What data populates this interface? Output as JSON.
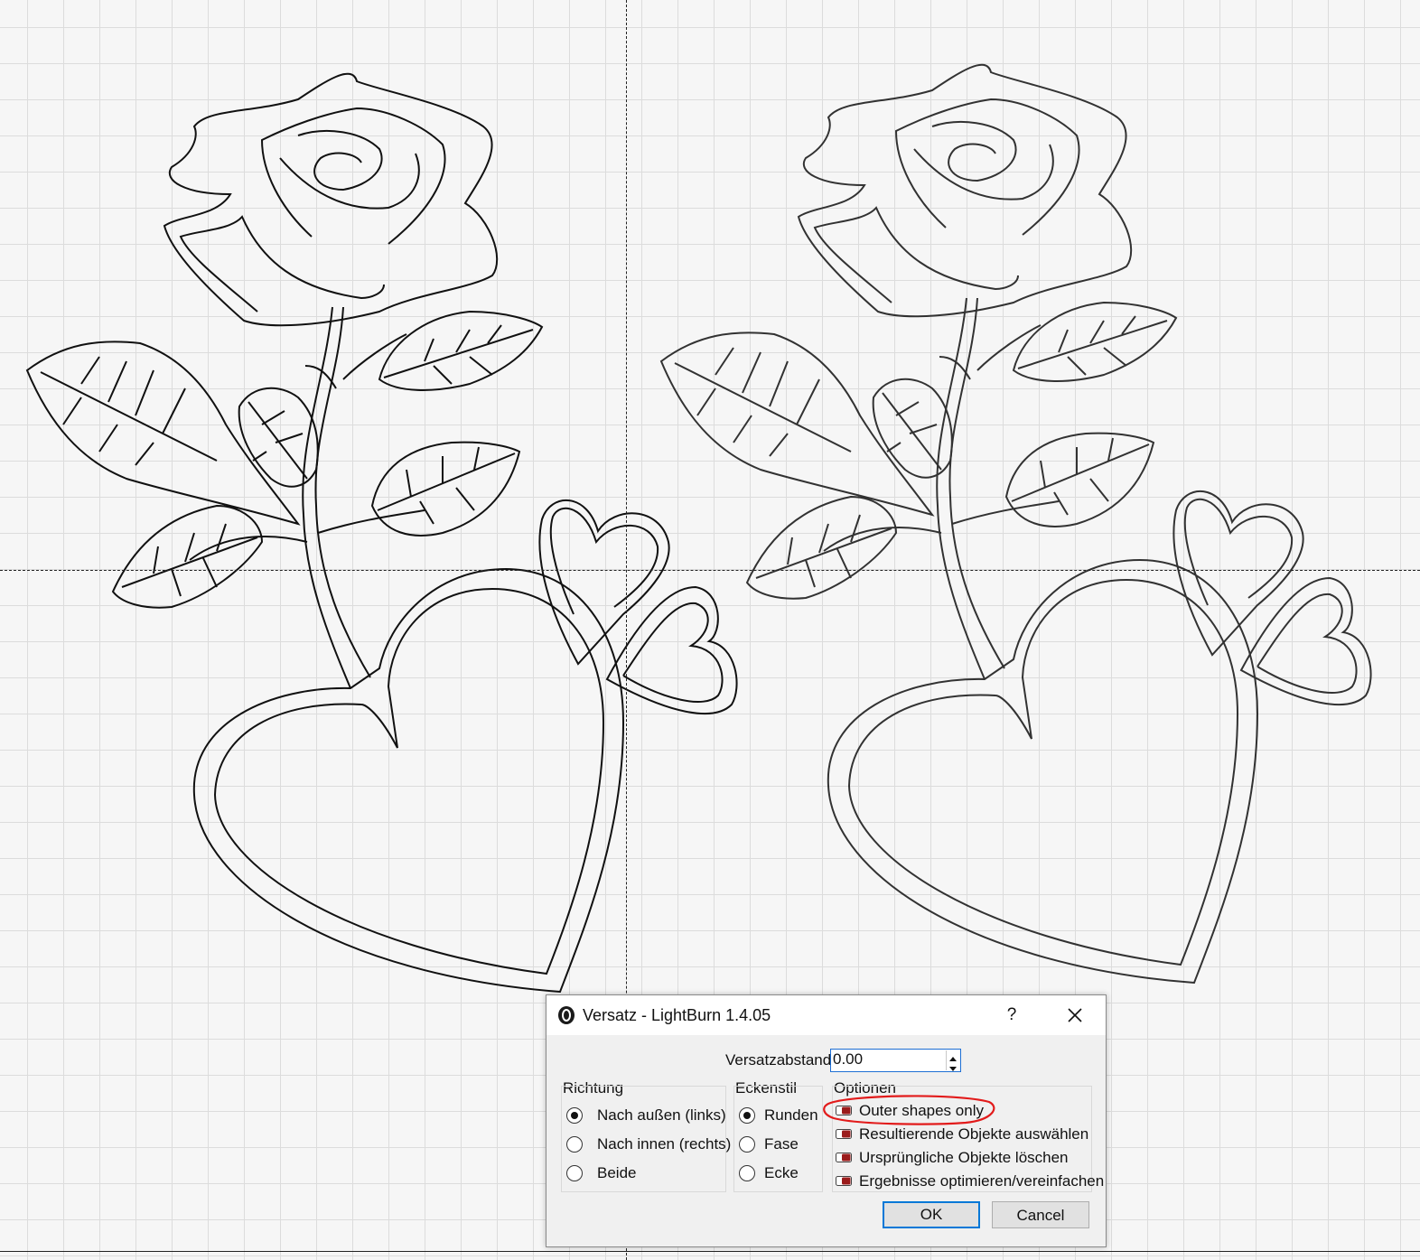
{
  "dialog": {
    "title": "Versatz - LightBurn 1.4.05",
    "help": "?",
    "offset_label": "Versatzabstand",
    "offset_value": "0.00",
    "direction": {
      "title": "Richtung",
      "options": [
        "Nach außen (links)",
        "Nach innen (rechts)",
        "Beide"
      ],
      "selected": "Nach außen (links)"
    },
    "corner": {
      "title": "Eckenstil",
      "options": [
        "Runden",
        "Fase",
        "Ecke"
      ],
      "selected": "Runden"
    },
    "options": {
      "title": "Optionen",
      "items": [
        "Outer shapes only",
        "Resultierende Objekte auswählen",
        "Ursprüngliche Objekte löschen",
        "Ergebnisse optimieren/vereinfachen"
      ]
    },
    "ok_label": "OK",
    "cancel_label": "Cancel"
  },
  "colors": {
    "canvas_bg": "#f6f6f6",
    "grid": "#dcdcdc",
    "annotation": "#e21b1b",
    "toggle": "#9b1b1b",
    "focus": "#0078d7"
  }
}
